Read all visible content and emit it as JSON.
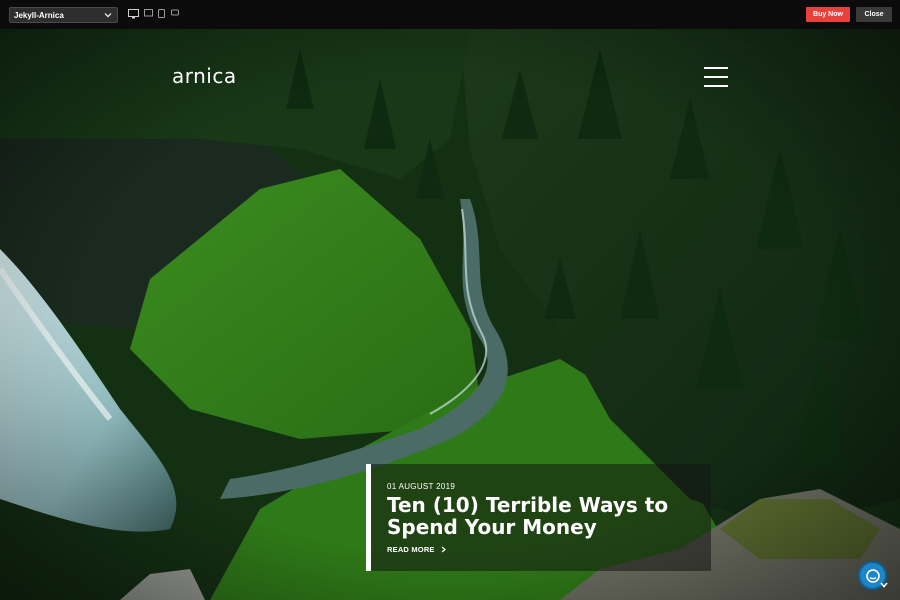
{
  "toolbar": {
    "theme_selector": "Jekyll-Arnica",
    "devices": [
      "desktop-icon",
      "laptop-icon",
      "tablet-icon",
      "mobile-icon"
    ],
    "buy_now": "Buy Now",
    "close": "Close",
    "accent": "#e8403b"
  },
  "site": {
    "brand": "arnica"
  },
  "featured_post": {
    "date": "01 AUGUST 2019",
    "title": "Ten (10) Terrible Ways to Spend Your Money",
    "read_more": "READ MORE"
  }
}
